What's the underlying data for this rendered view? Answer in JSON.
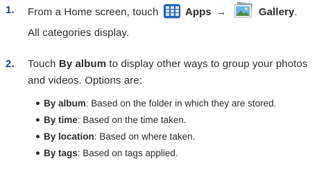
{
  "steps": [
    {
      "number": "1.",
      "text_before": "From a Home screen, touch",
      "apps_label": "Apps",
      "arrow": "→",
      "gallery_label": "Gallery",
      "period": ".",
      "subtext": "All categories display."
    },
    {
      "number": "2.",
      "text_before": "Touch",
      "by_album_label": "By album",
      "text_after": "to display other ways to group your photos",
      "line2": "and videos. Options are:",
      "options": [
        {
          "label": "By album",
          "description": ": Based on the folder in which they are stored."
        },
        {
          "label": "By time",
          "description": ": Based on the time taken."
        },
        {
          "label": "By location",
          "description": ": Based on where taken."
        },
        {
          "label": "By tags",
          "description": ": Based on tags applied."
        }
      ]
    }
  ],
  "icons": {
    "apps": "apps-grid-icon",
    "gallery": "gallery-photo-icon"
  },
  "colors": {
    "step_number": "#1f3f7a",
    "apps_icon": "#1e63b8",
    "text": "#2a2a2a"
  }
}
